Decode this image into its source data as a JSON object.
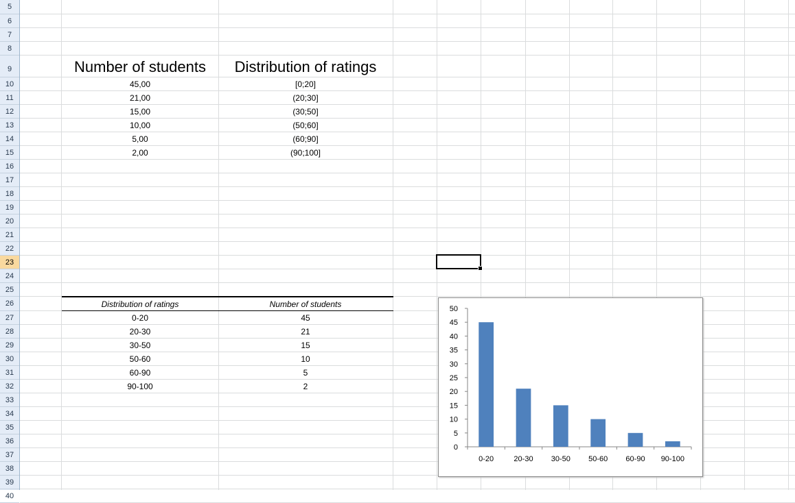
{
  "rows": [
    "5",
    "6",
    "7",
    "8",
    "9",
    "10",
    "11",
    "12",
    "13",
    "14",
    "15",
    "16",
    "17",
    "18",
    "19",
    "20",
    "21",
    "22",
    "23",
    "24",
    "25",
    "26",
    "27",
    "28",
    "29",
    "30",
    "31",
    "32",
    "33",
    "34",
    "35",
    "36",
    "37",
    "38",
    "39",
    "40"
  ],
  "active_row": "23",
  "table1": {
    "header_students": "Number of students",
    "header_ratings": "Distribution of ratings",
    "rows": [
      {
        "students": "45,00",
        "range": "[0;20]"
      },
      {
        "students": "21,00",
        "range": "(20;30]"
      },
      {
        "students": "15,00",
        "range": "(30;50]"
      },
      {
        "students": "10,00",
        "range": "(50;60]"
      },
      {
        "students": "5,00",
        "range": "(60;90]"
      },
      {
        "students": "2,00",
        "range": "(90;100]"
      }
    ]
  },
  "table2": {
    "header_ratings": "Distribution of ratings",
    "header_students": "Number of students",
    "rows": [
      {
        "range": "0-20",
        "students": "45"
      },
      {
        "range": "20-30",
        "students": "21"
      },
      {
        "range": "30-50",
        "students": "15"
      },
      {
        "range": "50-60",
        "students": "10"
      },
      {
        "range": "60-90",
        "students": "5"
      },
      {
        "range": "90-100",
        "students": "2"
      }
    ]
  },
  "chart_data": {
    "type": "bar",
    "categories": [
      "0-20",
      "20-30",
      "30-50",
      "50-60",
      "60-90",
      "90-100"
    ],
    "values": [
      45,
      21,
      15,
      10,
      5,
      2
    ],
    "ylim": [
      0,
      50
    ],
    "yticks": [
      0,
      5,
      10,
      15,
      20,
      25,
      30,
      35,
      40,
      45,
      50
    ],
    "bar_color": "#4f81bd",
    "grid": false,
    "legend": "none",
    "title": "",
    "xlabel": "",
    "ylabel": ""
  }
}
